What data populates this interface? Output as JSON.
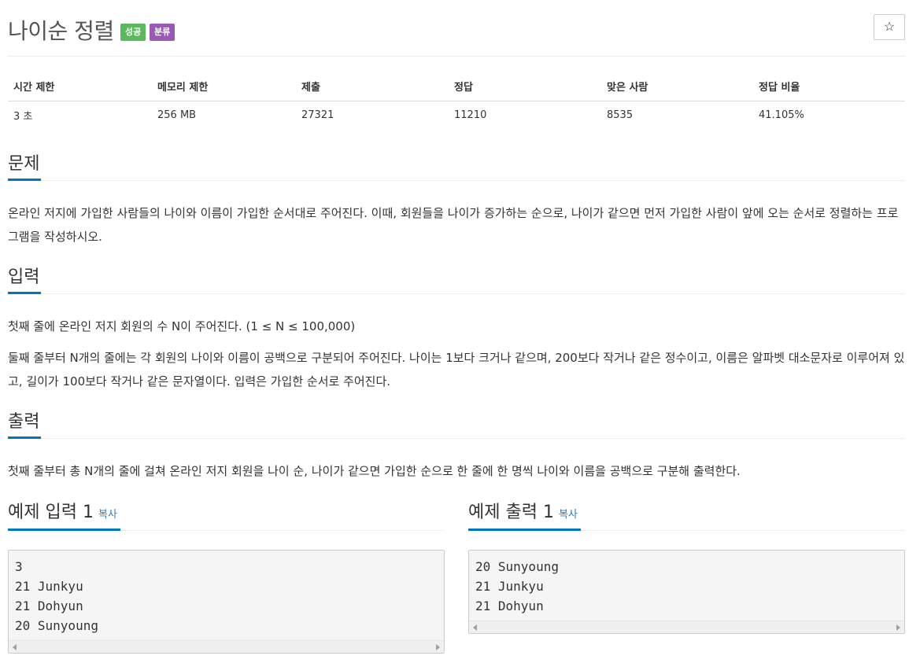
{
  "header": {
    "title": "나이순 정렬",
    "badge_success": "성공",
    "badge_category": "분류",
    "star": "☆"
  },
  "info": {
    "headers": [
      "시간 제한",
      "메모리 제한",
      "제출",
      "정답",
      "맞은 사람",
      "정답 비율"
    ],
    "values": [
      "3 초",
      "256 MB",
      "27321",
      "11210",
      "8535",
      "41.105%"
    ]
  },
  "problem": {
    "heading": "문제",
    "text": "온라인 저지에 가입한 사람들의 나이와 이름이 가입한 순서대로 주어진다. 이때, 회원들을 나이가 증가하는 순으로, 나이가 같으면 먼저 가입한 사람이 앞에 오는 순서로 정렬하는 프로그램을 작성하시오."
  },
  "input": {
    "heading": "입력",
    "line1": "첫째 줄에 온라인 저지 회원의 수 N이 주어진다. (1 ≤ N ≤ 100,000)",
    "line2": "둘째 줄부터 N개의 줄에는 각 회원의 나이와 이름이 공백으로 구분되어 주어진다. 나이는 1보다 크거나 같으며, 200보다 작거나 같은 정수이고, 이름은 알파벳 대소문자로 이루어져 있고, 길이가 100보다 작거나 같은 문자열이다. 입력은 가입한 순서로 주어진다."
  },
  "output": {
    "heading": "출력",
    "text": "첫째 줄부터 총 N개의 줄에 걸쳐 온라인 저지 회원을 나이 순, 나이가 같으면 가입한 순으로 한 줄에 한 명씩 나이와 이름을 공백으로 구분해 출력한다."
  },
  "sample_input": {
    "title": "예제 입력 1",
    "copy": "복사",
    "content": "3\n21 Junkyu\n21 Dohyun\n20 Sunyoung"
  },
  "sample_output": {
    "title": "예제 출력 1",
    "copy": "복사",
    "content": "20 Sunyoung\n21 Junkyu\n21 Dohyun"
  }
}
